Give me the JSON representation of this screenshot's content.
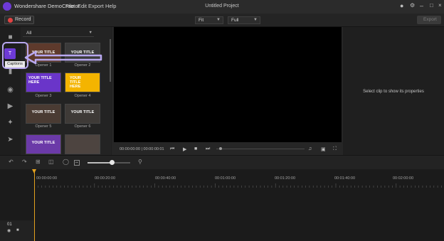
{
  "app": {
    "name": "Wondershare DemoCreator",
    "doc_title": "Untitled Project"
  },
  "menu": [
    {
      "label": "File"
    },
    {
      "label": "Edit"
    },
    {
      "label": "Export"
    },
    {
      "label": "Help"
    }
  ],
  "toolbar": {
    "record_label": "Record",
    "fit_label": "Fit",
    "full_label": "Full",
    "export_label": "Export"
  },
  "library": {
    "filter_label": "All",
    "tooltip": "Captions",
    "items": [
      {
        "label": "Opener 1",
        "text": "YOUR TITLE",
        "color": "#5e3a2c"
      },
      {
        "label": "Opener 2",
        "text": "YOUR TITLE",
        "color": "#3a3a3a"
      },
      {
        "label": "Opener 3",
        "text": "YOUR TITLE HERE",
        "color": "#6a35c9"
      },
      {
        "label": "Opener 4",
        "text": "YOUR TITLE HERE",
        "color": "#f4b400"
      },
      {
        "label": "Opener 5",
        "text": "YOUR TITLE",
        "color": "#4a3b33"
      },
      {
        "label": "Opener 6",
        "text": "YOUR TITLE",
        "color": "#3e3a37"
      },
      {
        "label": "",
        "text": "YOUR TITLE",
        "color": "#6b3aa8"
      },
      {
        "label": "",
        "text": "",
        "color": "#4d4440"
      }
    ]
  },
  "player": {
    "timecode": "00:00:00:00 | 00:00:00:01"
  },
  "properties": {
    "empty_message": "Select clip to show its properties"
  },
  "timeline": {
    "ticks": [
      "00:00:00:00",
      "00:00:20:00",
      "00:00:40:00",
      "00:01:00:00",
      "00:01:20:00",
      "00:01:40:00",
      "00:02:00:00"
    ],
    "track_number": "01"
  },
  "colors": {
    "accent": "#6d3ad6",
    "playhead": "#e3a11e",
    "record": "#e24242",
    "callout": "#b8a8f0"
  }
}
